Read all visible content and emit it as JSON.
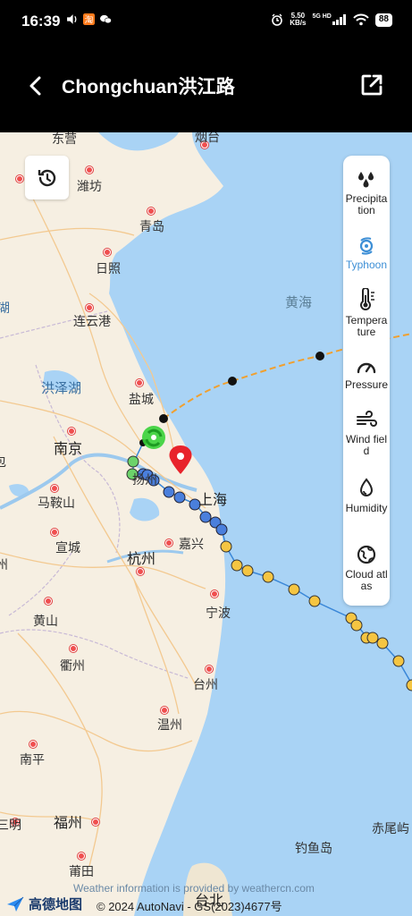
{
  "status_bar": {
    "time": "16:39",
    "speed_value": "5.50",
    "speed_unit": "KB/s",
    "network": "5G HD",
    "battery": "88"
  },
  "header": {
    "title": "Chongchuan洪江路",
    "back_icon": "chevron-left-icon",
    "share_icon": "external-link-icon"
  },
  "map": {
    "history_icon": "history-icon",
    "labels": {
      "dongying": "东营",
      "yantai": "烟台",
      "weifang": "潍坊",
      "qingdao": "青岛",
      "rizhao": "日照",
      "lianyungang": "连云港",
      "huanghai": "黄海",
      "hongzehu": "洪泽湖",
      "yancheng": "盐城",
      "nanjing": "南京",
      "yangzhou": "扬州",
      "shanghai": "上海",
      "maanshan": "马鞍山",
      "xuancheng": "宣城",
      "hangzhou": "杭州",
      "jiaxing": "嘉兴",
      "ningbo": "宁波",
      "huangshan": "黄山",
      "quzhou": "衢州",
      "taizhou": "台州",
      "wenzhou": "温州",
      "nanping": "南平",
      "sanming": "三明",
      "fuzhou": "福州",
      "putian": "莆田",
      "diaoyudao": "钓鱼岛",
      "chiweiyu": "赤尾屿",
      "taibei": "台北",
      "hu": "湖",
      "zhou": "州",
      "bao": "包"
    }
  },
  "layers": [
    {
      "label": "Precipitation",
      "icon": "raindrops-icon",
      "active": false
    },
    {
      "label": "Typhoon",
      "icon": "typhoon-icon",
      "active": true
    },
    {
      "label": "Temperature",
      "icon": "thermometer-icon",
      "active": false
    },
    {
      "label": "Pressure",
      "icon": "gauge-icon",
      "active": false
    },
    {
      "label": "Wind field",
      "icon": "wind-icon",
      "active": false
    },
    {
      "label": "Humidity",
      "icon": "humidity-drop-icon",
      "active": false
    },
    {
      "label": "Cloud atlas",
      "icon": "globe-icon",
      "active": false
    }
  ],
  "footer": {
    "logo_text": "高德地图",
    "copyright": "© 2024 AutoNavi - GS(2023)4677号",
    "weather_credit": "Weather information is provided by weathercn.com"
  },
  "colors": {
    "accent": "#3d8fd6",
    "sea": "#a9d3f5",
    "land": "#f6efe2",
    "track_past_blue": "#4a7fdc",
    "track_forecast_yellow": "#f5c542",
    "track_green": "#55cc44",
    "track_orange_dash": "#f0a030",
    "location_pin": "#e8232b"
  }
}
